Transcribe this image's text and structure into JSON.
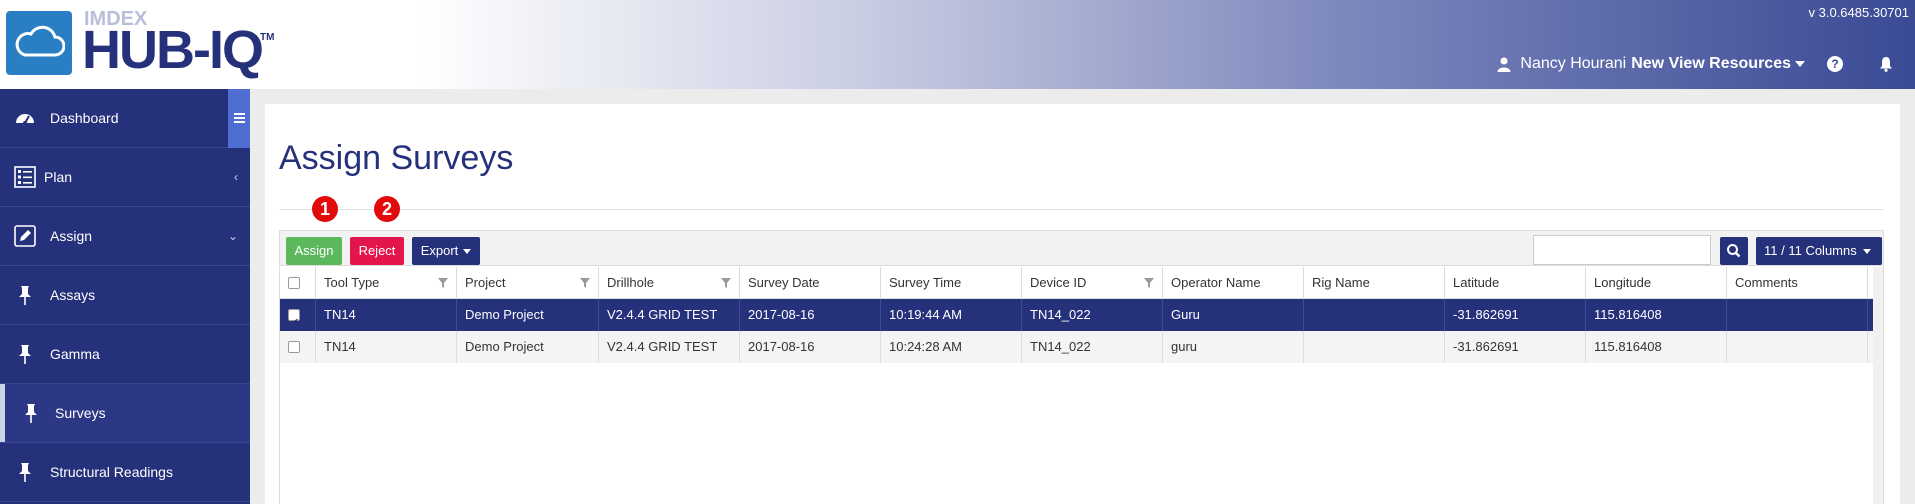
{
  "app": {
    "brand_top": "IMDEX",
    "brand_main": "HUB-IQ",
    "brand_tm": "TM",
    "version": "v 3.0.6485.30701"
  },
  "user": {
    "name": "Nancy Hourani",
    "org": "New View Resources"
  },
  "sidebar": {
    "items": [
      {
        "label": "Dashboard",
        "icon": "dashboard-icon"
      },
      {
        "label": "Plan",
        "icon": "list-icon",
        "chevron": "‹"
      },
      {
        "label": "Assign",
        "icon": "edit-icon",
        "chevron": "⌄"
      },
      {
        "label": "Assays",
        "icon": "pin-icon"
      },
      {
        "label": "Gamma",
        "icon": "pin-icon"
      },
      {
        "label": "Surveys",
        "icon": "pin-icon"
      },
      {
        "label": "Structural Readings",
        "icon": "pin-icon"
      }
    ]
  },
  "page": {
    "title": "Assign Surveys",
    "badges": [
      "1",
      "2"
    ]
  },
  "toolbar": {
    "assign_label": "Assign",
    "reject_label": "Reject",
    "export_label": "Export",
    "search_value": "",
    "columns_label": "11 / 11 Columns"
  },
  "table": {
    "columns": [
      "Tool Type",
      "Project",
      "Drillhole",
      "Survey Date",
      "Survey Time",
      "Device ID",
      "Operator Name",
      "Rig Name",
      "Latitude",
      "Longitude",
      "Comments"
    ],
    "rows": [
      {
        "checked": true,
        "cells": [
          "TN14",
          "Demo Project",
          "V2.4.4 GRID TEST",
          "2017-08-16",
          "10:19:44 AM",
          "TN14_022",
          "Guru",
          "",
          "-31.862691",
          "115.816408",
          ""
        ]
      },
      {
        "checked": false,
        "cells": [
          "TN14",
          "Demo Project",
          "V2.4.4 GRID TEST",
          "2017-08-16",
          "10:24:28 AM",
          "TN14_022",
          "guru",
          "",
          "-31.862691",
          "115.816408",
          ""
        ]
      }
    ]
  },
  "colors": {
    "navy": "#25317a",
    "assign_green": "#5cb85c",
    "reject_red": "#e4154b",
    "badge_red": "#e20a0a"
  }
}
